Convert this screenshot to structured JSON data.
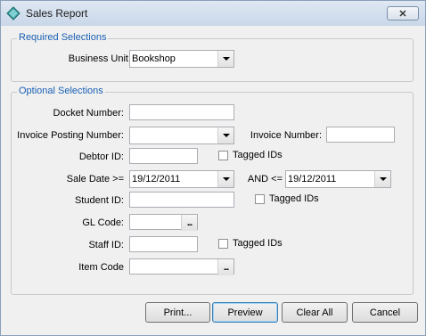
{
  "window": {
    "title": "Sales Report",
    "close_label": "✕"
  },
  "required": {
    "legend": "Required Selections",
    "business_unit_label": "Business Unit",
    "business_unit_value": "Bookshop"
  },
  "optional": {
    "legend": "Optional Selections",
    "docket_label": "Docket Number:",
    "invoice_posting_label": "Invoice Posting Number:",
    "invoice_number_label": "Invoice Number:",
    "debtor_label": "Debtor ID:",
    "tagged_ids_label": "Tagged IDs",
    "sale_date_label": "Sale Date >=",
    "sale_date_from": "19/12/2011",
    "and_label": "AND <=",
    "sale_date_to": "19/12/2011",
    "student_label": "Student ID:",
    "gl_code_label": "GL Code:",
    "staff_label": "Staff ID:",
    "item_code_label": "Item Code",
    "ellipsis": "..."
  },
  "buttons": {
    "print": "Print...",
    "preview": "Preview",
    "clear_all": "Clear All",
    "cancel": "Cancel"
  }
}
